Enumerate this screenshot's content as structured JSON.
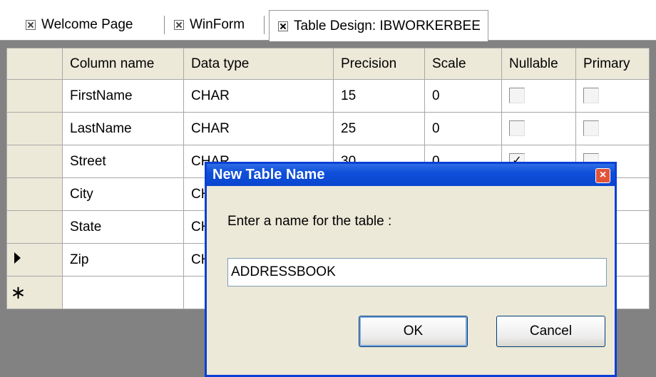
{
  "tabs": [
    {
      "label": "Welcome Page"
    },
    {
      "label": "WinForm"
    },
    {
      "label": "Table Design:  IBWORKERBEE"
    }
  ],
  "grid": {
    "headers": [
      "Column name",
      "Data type",
      "Precision",
      "Scale",
      "Nullable",
      "Primary"
    ],
    "rows": [
      {
        "name": "FirstName",
        "type": "CHAR",
        "precision": "15",
        "scale": "0",
        "nullable": false,
        "primary": false
      },
      {
        "name": "LastName",
        "type": "CHAR",
        "precision": "25",
        "scale": "0",
        "nullable": false,
        "primary": false
      },
      {
        "name": "Street",
        "type": "CHAR",
        "precision": "30",
        "scale": "0",
        "nullable": true,
        "primary": false
      },
      {
        "name": "City",
        "type": "CH",
        "precision": "",
        "scale": "",
        "nullable": false,
        "primary": false
      },
      {
        "name": "State",
        "type": "CH",
        "precision": "",
        "scale": "",
        "nullable": false,
        "primary": false
      },
      {
        "name": "Zip",
        "type": "CH",
        "precision": "",
        "scale": "",
        "nullable": false,
        "primary": false
      }
    ],
    "current_row_marker": "▶",
    "new_row_marker": "∗"
  },
  "dialog": {
    "title": "New Table Name",
    "close_glyph": "×",
    "prompt": "Enter a name for the table :",
    "input_value": "ADDRESSBOOK",
    "ok_label": "OK",
    "cancel_label": "Cancel"
  },
  "colors": {
    "title_bar": "#0a46d0",
    "dialog_bg": "#ece9d8",
    "grid_bg": "#828282",
    "close_button": "#e0543a"
  }
}
